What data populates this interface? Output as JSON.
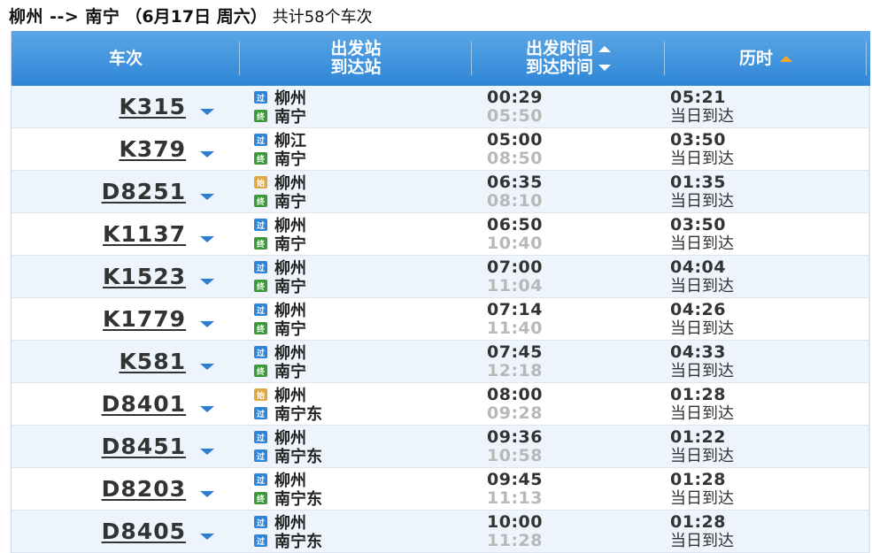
{
  "header": {
    "route": "柳州 --> 南宁",
    "date": "（6月17日  周六）",
    "count": "共计58个车次"
  },
  "table": {
    "col_train": "车次",
    "col_from": "出发站",
    "col_to": "到达站",
    "col_dep": "出发时间",
    "col_arr": "到达时间",
    "col_duration": "历时"
  },
  "badges": {
    "pass": "过",
    "start": "始",
    "end": "终"
  },
  "colors": {
    "header_blue": "#2f86d6",
    "accent_orange": "#f5a623",
    "badge_start": "#e0a845",
    "badge_end": "#3d9a3a"
  },
  "rows": [
    {
      "train": "K315",
      "from": "柳州",
      "from_badge": "过",
      "to": "南宁",
      "to_badge": "终",
      "dep": "00:29",
      "arr": "05:50",
      "duration": "05:21",
      "arrive_note": "当日到达"
    },
    {
      "train": "K379",
      "from": "柳江",
      "from_badge": "过",
      "to": "南宁",
      "to_badge": "终",
      "dep": "05:00",
      "arr": "08:50",
      "duration": "03:50",
      "arrive_note": "当日到达"
    },
    {
      "train": "D8251",
      "from": "柳州",
      "from_badge": "始",
      "to": "南宁",
      "to_badge": "终",
      "dep": "06:35",
      "arr": "08:10",
      "duration": "01:35",
      "arrive_note": "当日到达"
    },
    {
      "train": "K1137",
      "from": "柳州",
      "from_badge": "过",
      "to": "南宁",
      "to_badge": "终",
      "dep": "06:50",
      "arr": "10:40",
      "duration": "03:50",
      "arrive_note": "当日到达"
    },
    {
      "train": "K1523",
      "from": "柳州",
      "from_badge": "过",
      "to": "南宁",
      "to_badge": "终",
      "dep": "07:00",
      "arr": "11:04",
      "duration": "04:04",
      "arrive_note": "当日到达"
    },
    {
      "train": "K1779",
      "from": "柳州",
      "from_badge": "过",
      "to": "南宁",
      "to_badge": "终",
      "dep": "07:14",
      "arr": "11:40",
      "duration": "04:26",
      "arrive_note": "当日到达"
    },
    {
      "train": "K581",
      "from": "柳州",
      "from_badge": "过",
      "to": "南宁",
      "to_badge": "终",
      "dep": "07:45",
      "arr": "12:18",
      "duration": "04:33",
      "arrive_note": "当日到达"
    },
    {
      "train": "D8401",
      "from": "柳州",
      "from_badge": "始",
      "to": "南宁东",
      "to_badge": "过",
      "dep": "08:00",
      "arr": "09:28",
      "duration": "01:28",
      "arrive_note": "当日到达"
    },
    {
      "train": "D8451",
      "from": "柳州",
      "from_badge": "过",
      "to": "南宁东",
      "to_badge": "过",
      "dep": "09:36",
      "arr": "10:58",
      "duration": "01:22",
      "arrive_note": "当日到达"
    },
    {
      "train": "D8203",
      "from": "柳州",
      "from_badge": "过",
      "to": "南宁东",
      "to_badge": "终",
      "dep": "09:45",
      "arr": "11:13",
      "duration": "01:28",
      "arrive_note": "当日到达"
    },
    {
      "train": "D8405",
      "from": "柳州",
      "from_badge": "过",
      "to": "南宁东",
      "to_badge": "过",
      "dep": "10:00",
      "arr": "11:28",
      "duration": "01:28",
      "arrive_note": "当日到达"
    }
  ]
}
